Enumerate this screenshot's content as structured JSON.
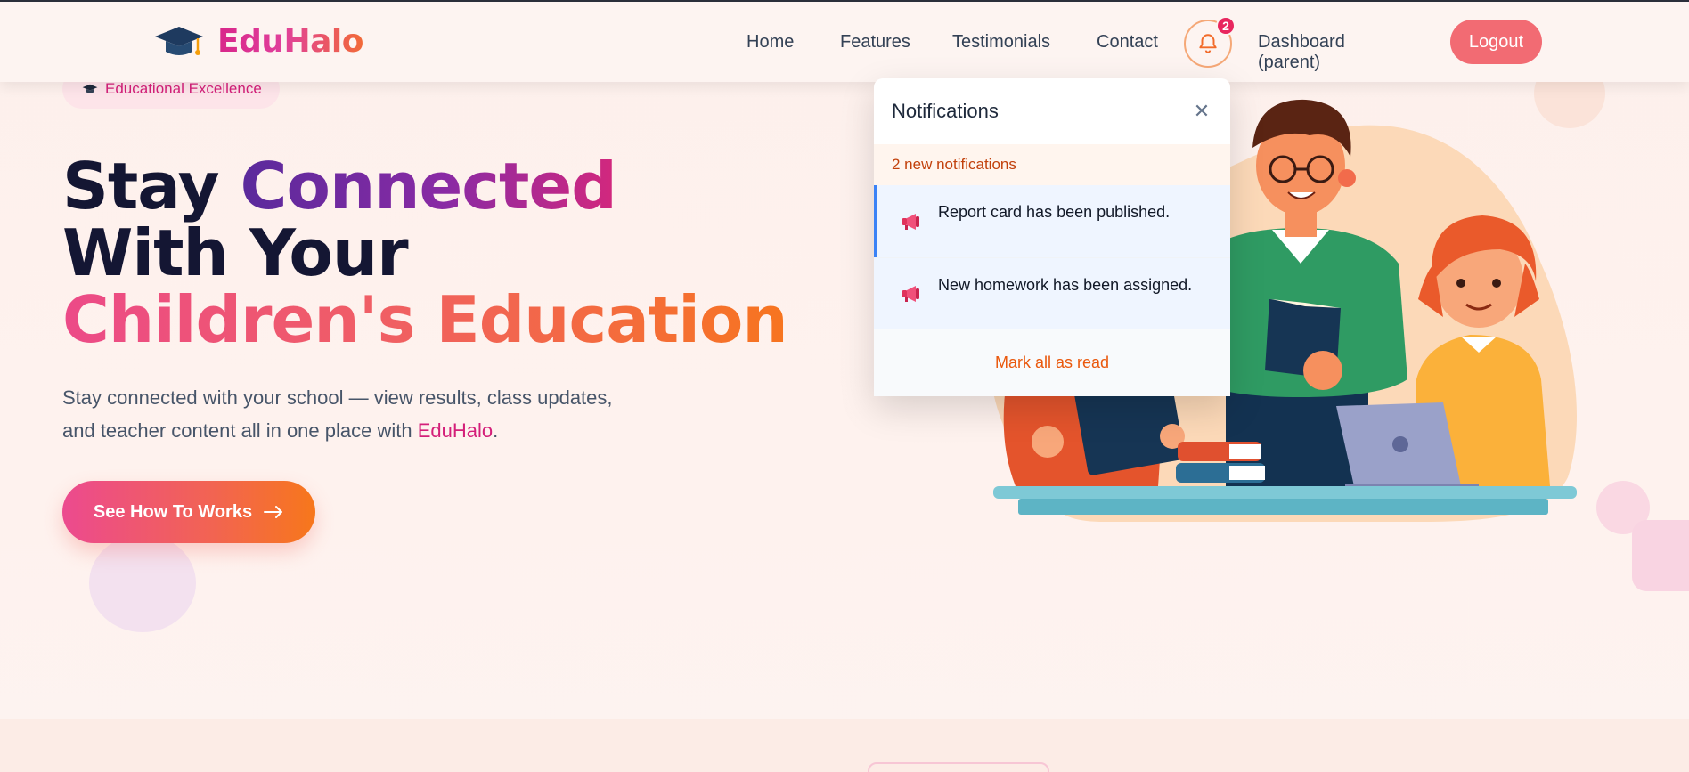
{
  "brand": {
    "name": "EduHalo",
    "logo_icon": "graduation-cap-icon"
  },
  "nav": {
    "links": [
      "Home",
      "Features",
      "Testimonials",
      "Contact"
    ],
    "notifications_badge": "2",
    "dashboard_label": "Dashboard (parent)",
    "logout_label": "Logout"
  },
  "hero": {
    "tag_label": "Educational Excellence",
    "headline": {
      "line1_plain": "Stay",
      "line1_accent": "Connected",
      "line2": "With Your",
      "line3": "Children's Education"
    },
    "subtext_before": "Stay connected with your school — view results, class updates, and teacher content all in one place with",
    "subtext_brand": "EduHalo",
    "subtext_after": ".",
    "cta_label": "See How To Works",
    "cta_icon": "arrow-right-icon"
  },
  "notifications": {
    "title": "Notifications",
    "count_label": "2 new notifications",
    "items": [
      {
        "text": "Report card has been published.",
        "icon": "megaphone-icon"
      },
      {
        "text": "New homework has been assigned.",
        "icon": "megaphone-icon"
      }
    ],
    "mark_all_label": "Mark all as read"
  },
  "colors": {
    "brand_pink": "#d41f79",
    "brand_orange": "#f7751f",
    "logout_bg": "#f26b73",
    "notification_accent": "#3b82f6",
    "mark_read": "#ea580c"
  }
}
